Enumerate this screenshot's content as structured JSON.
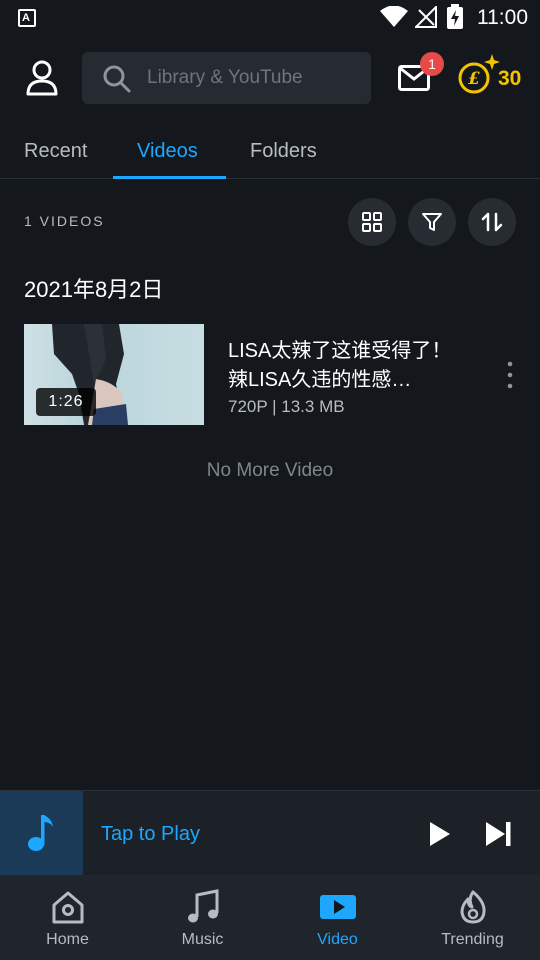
{
  "status_bar": {
    "time": "11:00"
  },
  "header": {
    "search_placeholder": "Library & YouTube",
    "mail_badge": "1",
    "coin_count": "30"
  },
  "tabs": [
    {
      "label": "Recent"
    },
    {
      "label": "Videos"
    },
    {
      "label": "Folders"
    }
  ],
  "content": {
    "count_label": "1 VIDEOS",
    "date_header": "2021年8月2日",
    "video": {
      "duration": "1:26",
      "title": "LISA太辣了这谁受得了！辣LISA久违的性感…",
      "meta": "720P | 13.3 MB"
    },
    "no_more": "No More Video"
  },
  "mini_player": {
    "label": "Tap to Play"
  },
  "bottom_nav": [
    {
      "label": "Home"
    },
    {
      "label": "Music"
    },
    {
      "label": "Video"
    },
    {
      "label": "Trending"
    }
  ],
  "colors": {
    "accent": "#1ea7ff",
    "coin": "#f5c400",
    "badge": "#e84a4a",
    "background": "#14181d"
  }
}
